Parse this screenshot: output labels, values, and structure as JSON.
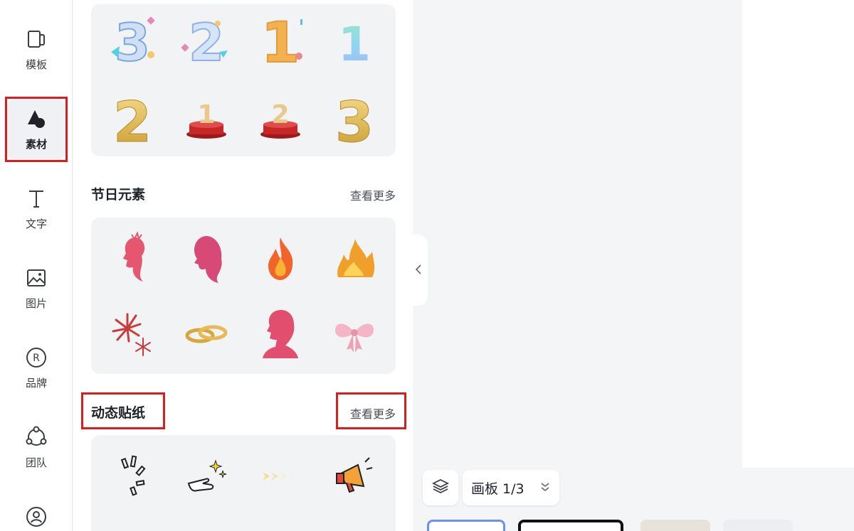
{
  "nav": {
    "items": [
      {
        "label": "模板",
        "icon": "template-icon"
      },
      {
        "label": "素材",
        "icon": "material-icon"
      },
      {
        "label": "文字",
        "icon": "text-icon"
      },
      {
        "label": "图片",
        "icon": "image-icon"
      },
      {
        "label": "品牌",
        "icon": "brand-icon"
      },
      {
        "label": "团队",
        "icon": "team-icon"
      },
      {
        "label": "",
        "icon": "user-icon"
      }
    ]
  },
  "sections": {
    "festival": {
      "title": "节日元素",
      "more": "查看更多"
    },
    "animated": {
      "title": "动态贴纸",
      "more": "查看更多"
    }
  },
  "stickers_top": {
    "row1": [
      "3",
      "2",
      "1",
      "1"
    ],
    "row2": [
      "2",
      "1",
      "2",
      "3"
    ]
  },
  "board": {
    "label": "画板 1/3"
  },
  "colors": {
    "highlight": "#d91e1e",
    "accent": "#6f8cff"
  }
}
